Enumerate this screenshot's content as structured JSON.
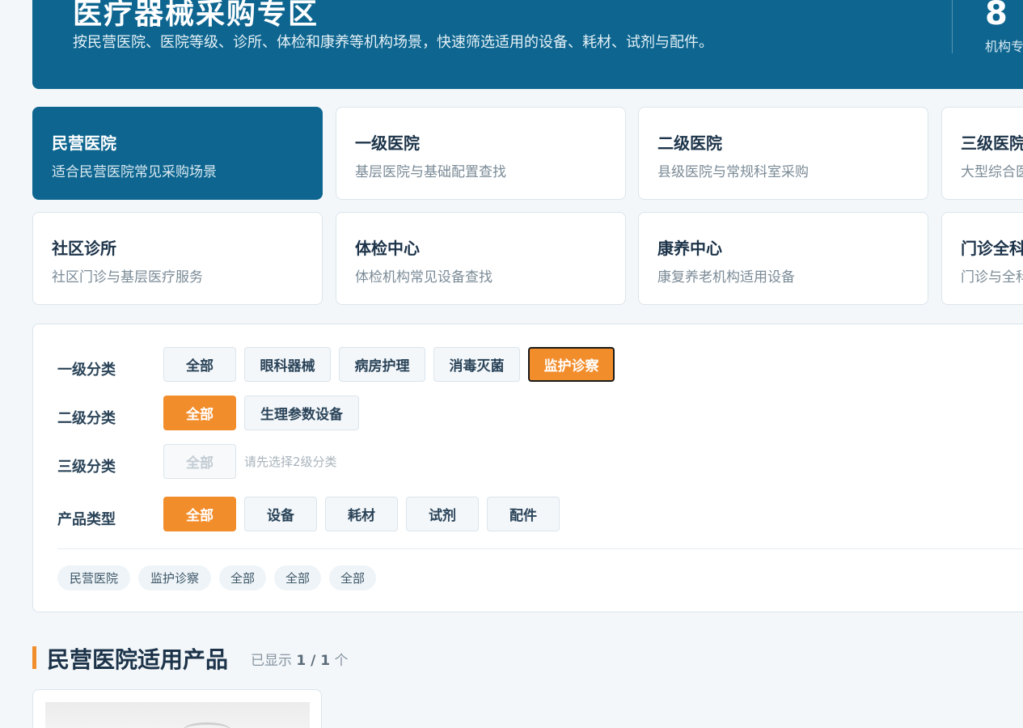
{
  "hero": {
    "title": "医疗器械采购专区",
    "description": "按民营医院、医院等级、诊所、体检和康养等机构场景，快速筛选适用的设备、耗材、试剂与配件。",
    "stat_value": "8",
    "stat_label": "机构专区"
  },
  "scenes": [
    {
      "name": "民营医院",
      "sub": "适合民营医院常见采购场景",
      "active": true
    },
    {
      "name": "一级医院",
      "sub": "基层医院与基础配置查找"
    },
    {
      "name": "二级医院",
      "sub": "县级医院与常规科室采购"
    },
    {
      "name": "三级医院",
      "sub": "大型综合医院"
    },
    {
      "name": "社区诊所",
      "sub": "社区门诊与基层医疗服务"
    },
    {
      "name": "体检中心",
      "sub": "体检机构常见设备查找"
    },
    {
      "name": "康养中心",
      "sub": "康复养老机构适用设备"
    },
    {
      "name": "门诊全科",
      "sub": "门诊与全科"
    }
  ],
  "filters": {
    "level1": {
      "label": "一级分类",
      "options": [
        "全部",
        "眼科器械",
        "病房护理",
        "消毒灭菌",
        "监护诊察"
      ]
    },
    "level2": {
      "label": "二级分类",
      "options": [
        "全部",
        "生理参数设备"
      ]
    },
    "level3": {
      "label": "三级分类",
      "options": [
        "全部"
      ],
      "hint": "请先选择2级分类"
    },
    "product_type": {
      "label": "产品类型",
      "options": [
        "全部",
        "设备",
        "耗材",
        "试剂",
        "配件"
      ]
    }
  },
  "selected_tags": [
    "民营医院",
    "监护诊察",
    "全部",
    "全部",
    "全部"
  ],
  "section": {
    "title": "民营医院适用产品",
    "count_prefix": "已显示",
    "count_shown": "1",
    "count_sep": " / ",
    "count_total": "1",
    "count_suffix": "个"
  },
  "colors": {
    "primary": "#0e6690",
    "accent": "#f28d2c",
    "background": "#f3f7fa"
  }
}
